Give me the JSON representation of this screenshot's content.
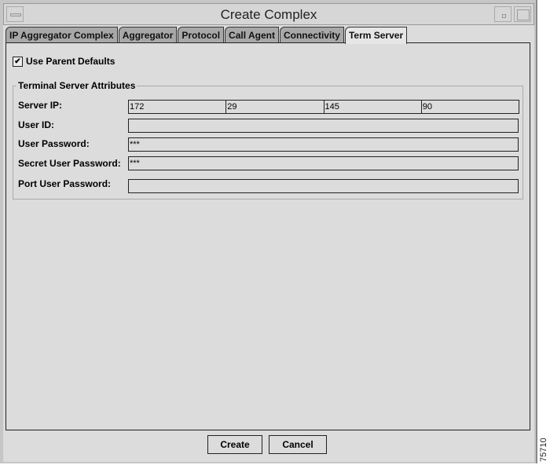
{
  "window": {
    "title": "Create Complex"
  },
  "tabs": [
    {
      "label": "IP Aggregator Complex"
    },
    {
      "label": "Aggregator"
    },
    {
      "label": "Protocol"
    },
    {
      "label": "Call Agent"
    },
    {
      "label": "Connectivity"
    },
    {
      "label": "Term Server",
      "active": true
    }
  ],
  "use_parent_defaults": {
    "label": "Use Parent Defaults",
    "checked": true,
    "mark": "✔"
  },
  "group": {
    "title": "Terminal Server Attributes",
    "server_ip": {
      "label": "Server IP:",
      "octets": [
        "172",
        "29",
        "145",
        "90"
      ]
    },
    "user_id": {
      "label": "User ID:",
      "value": ""
    },
    "user_password": {
      "label": "User Password:",
      "value": "***"
    },
    "secret_user_password": {
      "label": "Secret User Password:",
      "value": "***"
    },
    "port_user_password": {
      "label": "Port User Password:",
      "value": ""
    }
  },
  "buttons": {
    "create": "Create",
    "cancel": "Cancel"
  },
  "figure_id": "75710"
}
